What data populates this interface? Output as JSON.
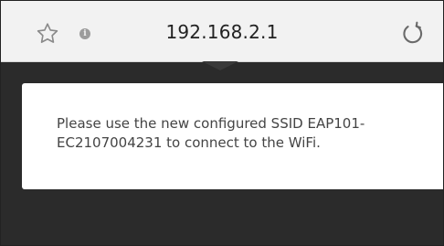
{
  "browser": {
    "url": "192.168.2.1",
    "bookmark_icon": "star-outline-icon",
    "info_icon": "info-icon",
    "reload_icon": "reload-icon"
  },
  "dialog": {
    "message": "Please use the new configured SSID EAP101-EC2107004231 to connect to the WiFi."
  },
  "colors": {
    "address_bar_bg": "#f2f2f2",
    "overlay_bg": "#2b2b2b",
    "dialog_bg": "#ffffff"
  }
}
